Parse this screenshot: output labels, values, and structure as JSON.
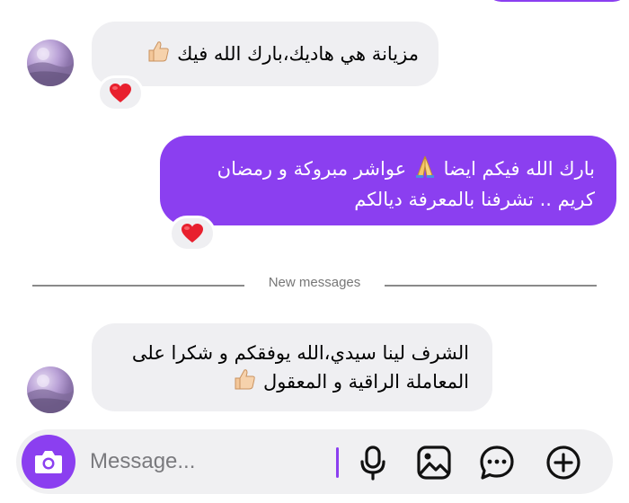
{
  "messages": [
    {
      "id": "m1",
      "direction": "incoming",
      "lines": [
        "مزيانة هي هاديك،بارك الله فيك"
      ],
      "emoji": "thumbs-up",
      "reaction": "heart"
    },
    {
      "id": "m2",
      "direction": "outgoing",
      "lines": [
        "بارك الله فيكم ايضا",
        "عواشر مبروكة و رمضان",
        "كريم .. تشرفنا بالمعرفة ديالكم"
      ],
      "emoji": "pray",
      "reaction": "heart"
    },
    {
      "id": "m3",
      "direction": "incoming",
      "lines": [
        "الشرف لينا سيدي،الله يوفقكم و شكرا على",
        "المعاملة الراقية و المعقول"
      ],
      "emoji": "thumbs-up"
    }
  ],
  "divider": {
    "label": "New messages"
  },
  "composer": {
    "placeholder": "Message...",
    "value": ""
  },
  "icons": [
    "camera-icon",
    "microphone-icon",
    "gallery-icon",
    "sticker-chat-icon",
    "plus-icon",
    "heart-icon",
    "thumbs-up-icon",
    "pray-icon"
  ],
  "colors": {
    "accent": "#8b3ff0",
    "incoming_bubble": "#efeff2",
    "heart": "#e8202e",
    "background": "#ffffff"
  }
}
